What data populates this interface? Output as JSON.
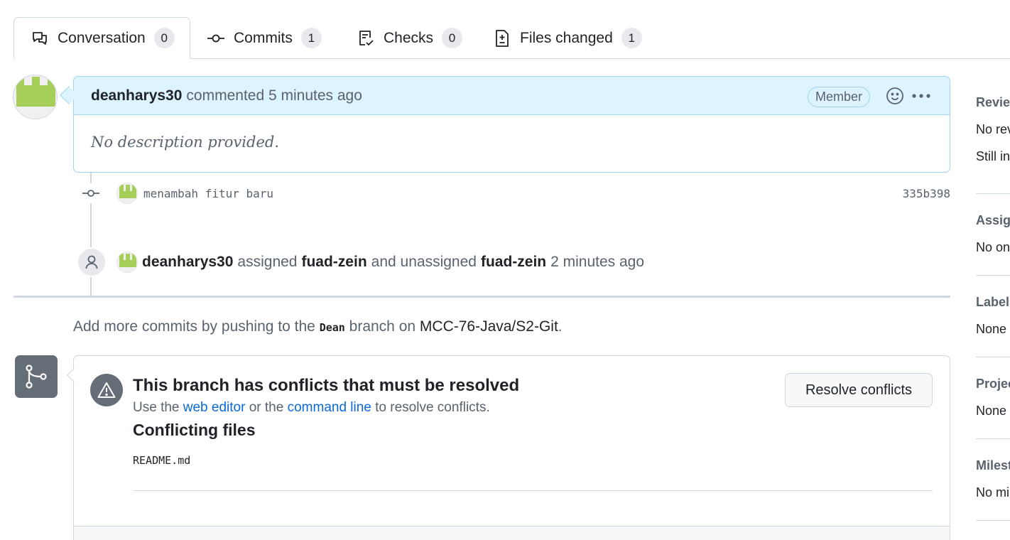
{
  "tabs": [
    {
      "label": "Conversation",
      "count": "0"
    },
    {
      "label": "Commits",
      "count": "1"
    },
    {
      "label": "Checks",
      "count": "0"
    },
    {
      "label": "Files changed",
      "count": "1"
    }
  ],
  "comment": {
    "author": "deanharys30",
    "meta": "commented 5 minutes ago",
    "badge": "Member",
    "body": "No description provided."
  },
  "commit": {
    "message": "menambah fitur baru",
    "sha": "335b398"
  },
  "assign_event": {
    "actor": "deanharys30",
    "verb1": "assigned",
    "target1": "fuad-zein",
    "verb2": "and unassigned",
    "target2": "fuad-zein",
    "time": "2 minutes ago"
  },
  "push_hint": {
    "prefix": "Add more commits by pushing to the",
    "branch": "Dean",
    "middle": "branch on",
    "repo": "MCC-76-Java/S2-Git",
    "suffix": "."
  },
  "merge": {
    "title": "This branch has conflicts that must be resolved",
    "sub_prefix": "Use the",
    "link1": "web editor",
    "sub_mid": "or the",
    "link2": "command line",
    "sub_suffix": "to resolve conflicts.",
    "conflicting_title": "Conflicting files",
    "file": "README.md",
    "resolve_button": "Resolve conflicts"
  },
  "sidebar": {
    "reviewers": {
      "title": "Reviewers",
      "line1": "No reviews",
      "line2": "Still in progress?"
    },
    "assignees": {
      "title": "Assignees",
      "value": "No one—"
    },
    "labels": {
      "title": "Labels",
      "value": "None yet"
    },
    "projects": {
      "title": "Projects",
      "value": "None yet"
    },
    "milestone": {
      "title": "Milestone",
      "value": "No milestone"
    }
  }
}
